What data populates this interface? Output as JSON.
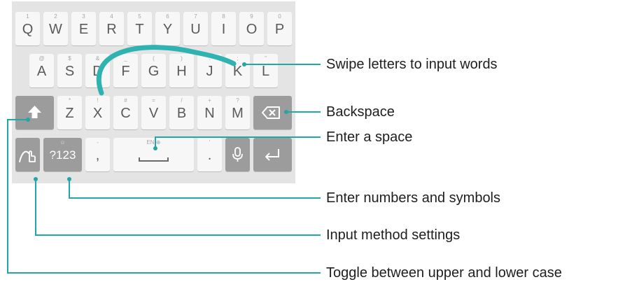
{
  "keyboard": {
    "rows": [
      {
        "keys": [
          {
            "main": "Q",
            "sub": "1"
          },
          {
            "main": "W",
            "sub": "2"
          },
          {
            "main": "E",
            "sub": "3"
          },
          {
            "main": "R",
            "sub": "4"
          },
          {
            "main": "T",
            "sub": "5"
          },
          {
            "main": "Y",
            "sub": "6"
          },
          {
            "main": "U",
            "sub": "7"
          },
          {
            "main": "I",
            "sub": "8"
          },
          {
            "main": "O",
            "sub": "9"
          },
          {
            "main": "P",
            "sub": "0"
          }
        ]
      },
      {
        "keys": [
          {
            "main": "A",
            "sub": "@"
          },
          {
            "main": "S",
            "sub": "$"
          },
          {
            "main": "D",
            "sub": "&"
          },
          {
            "main": "F",
            "sub": "_"
          },
          {
            "main": "G",
            "sub": "("
          },
          {
            "main": "H",
            "sub": ")"
          },
          {
            "main": "J",
            "sub": ":"
          },
          {
            "main": "K",
            "sub": ";"
          },
          {
            "main": "L",
            "sub": "\""
          }
        ]
      },
      {
        "keys": [
          {
            "main": "Z",
            "sub": "*"
          },
          {
            "main": "X",
            "sub": "!"
          },
          {
            "main": "C",
            "sub": "#"
          },
          {
            "main": "V",
            "sub": "="
          },
          {
            "main": "B",
            "sub": "/"
          },
          {
            "main": "N",
            "sub": "+"
          },
          {
            "main": "M",
            "sub": "?"
          }
        ]
      }
    ],
    "number_key": {
      "main": "?123",
      "sub": "☺"
    },
    "comma_key": {
      "main": ",",
      "sub": "-"
    },
    "space_key": {
      "sub": "EN ⊕"
    },
    "period_key": {
      "main": ".",
      "sub": "'"
    },
    "icons": {
      "shift": "shift-arrow-icon",
      "backspace": "backspace-icon",
      "settings": "swipe-hand-icon",
      "mic": "microphone-icon",
      "enter": "enter-arrow-icon"
    }
  },
  "callouts": [
    {
      "text": "Swipe letters to input words"
    },
    {
      "text": "Backspace"
    },
    {
      "text": "Enter a space"
    },
    {
      "text": "Enter numbers and symbols"
    },
    {
      "text": "Input method settings"
    },
    {
      "text": "Toggle between upper and lower case"
    }
  ],
  "colors": {
    "leader": "#23a6a6",
    "swipe_trace": "#2fb3b1",
    "keyboard_bg": "#e4e4e4",
    "key_light": "#f7f7f7",
    "key_dark": "#9c9c9c"
  }
}
